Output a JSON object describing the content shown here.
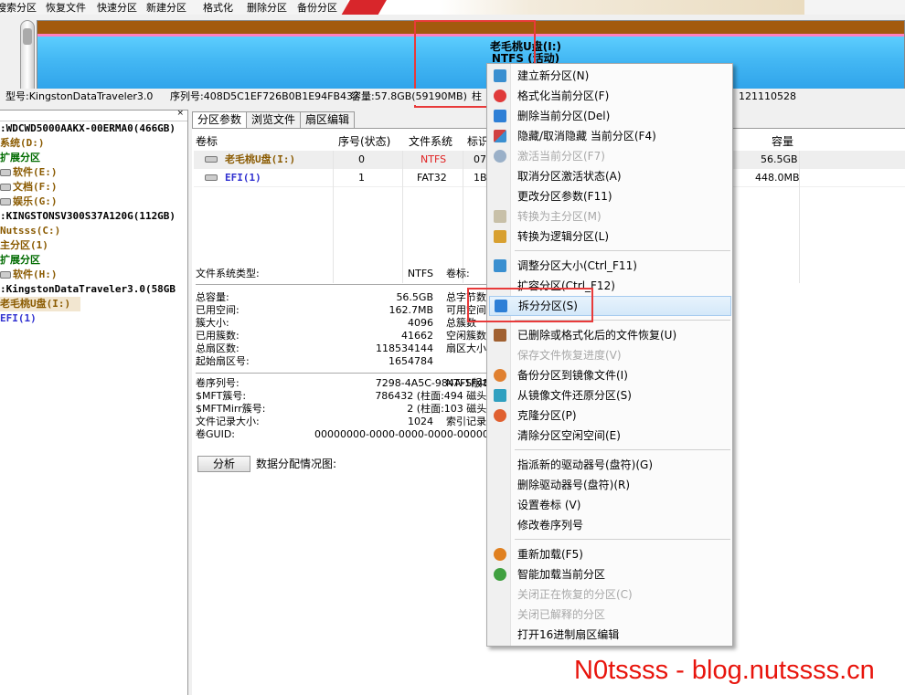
{
  "toolbar": {
    "items": [
      "搜索分区",
      "恢复文件",
      "快速分区",
      "新建分区",
      "格式化",
      "删除分区",
      "备份分区"
    ]
  },
  "disk": {
    "partition_label": "老毛桃U盘(I:)",
    "partition_fs": "NTFS (活动)",
    "info": {
      "model": "型号:KingstonDataTraveler3.0",
      "serial": "序列号:408D5C1EF726B0B1E94FB437",
      "capacity": "容量:57.8GB(59190MB)",
      "col": "柱",
      "sectors": "121110528"
    }
  },
  "tree": {
    "items": [
      {
        "text": ":WDCWD5000AAKX-00ERMA0(466GB)",
        "color": "black"
      },
      {
        "text": "系统(D:)",
        "color": "brown"
      },
      {
        "text": "扩展分区",
        "color": "green"
      },
      {
        "text": "软件(E:)",
        "color": "brown"
      },
      {
        "text": "文档(F:)",
        "color": "brown"
      },
      {
        "text": "娱乐(G:)",
        "color": "brown"
      },
      {
        "text": ":KINGSTONSV300S37A120G(112GB)",
        "color": "black"
      },
      {
        "text": "Nutsss(C:)",
        "color": "brown"
      },
      {
        "text": "主分区(1)",
        "color": "brown"
      },
      {
        "text": "扩展分区",
        "color": "green"
      },
      {
        "text": "软件(H:)",
        "color": "brown"
      },
      {
        "text": ":KingstonDataTraveler3.0(58GB",
        "color": "black"
      },
      {
        "text": "老毛桃U盘(I:)",
        "color": "brown"
      },
      {
        "text": "EFI(1)",
        "color": "blue"
      }
    ]
  },
  "tabs": [
    "分区参数",
    "浏览文件",
    "扇区编辑"
  ],
  "partition_table": {
    "headers": [
      "卷标",
      "序号(状态)",
      "文件系统",
      "标识",
      "容量"
    ],
    "rows": [
      {
        "label": "老毛桃U盘(I:)",
        "index": "0",
        "fs": "NTFS",
        "id": "07",
        "size": "56.5GB"
      },
      {
        "label": "EFI(1)",
        "index": "1",
        "fs": "FAT32",
        "id": "1B",
        "size": "448.0MB"
      }
    ]
  },
  "fs_info": {
    "fs_type_label": "文件系统类型:",
    "fs_type_value": "NTFS",
    "volume_label_key": "卷标:",
    "group1": [
      {
        "k": "总容量:",
        "v": "56.5GB",
        "k2": "总字节数"
      },
      {
        "k": "已用空间:",
        "v": "162.7MB",
        "k2": "可用空间"
      },
      {
        "k": "簇大小:",
        "v": "4096",
        "k2": "总簇数"
      },
      {
        "k": "已用簇数:",
        "v": "41662",
        "k2": "空闲簇数"
      },
      {
        "k": "总扇区数:",
        "v": "118534144",
        "k2": "扇区大小"
      },
      {
        "k": "起始扇区号:",
        "v": "1654784",
        "k2": ""
      }
    ],
    "group2": [
      {
        "k": "卷序列号:",
        "v": "7298-4A5C-984A-1F4B",
        "k2": "NTFS版本"
      },
      {
        "k": "$MFT簇号:",
        "v": "786432 (柱面:494 磁头:",
        "k2": ""
      },
      {
        "k": "$MFTMirr簇号:",
        "v": "2 (柱面:103 磁头:",
        "k2": ""
      },
      {
        "k": "文件记录大小:",
        "v": "1024",
        "k2": "索引记录"
      },
      {
        "k": "卷GUID:",
        "v": "00000000-0000-0000-0000-00000000",
        "k2": ""
      }
    ]
  },
  "analyze": {
    "button": "分析",
    "label": "数据分配情况图:"
  },
  "context_menu": {
    "items": [
      {
        "label": "建立新分区(N)",
        "disabled": false,
        "icon": "new-partition-icon",
        "color": "#3a8fd0"
      },
      {
        "label": "格式化当前分区(F)",
        "disabled": false,
        "icon": "format-icon",
        "color": "#e03a3a"
      },
      {
        "label": "删除当前分区(Del)",
        "disabled": false,
        "icon": "delete-icon",
        "color": "#2e7fd6"
      },
      {
        "label": "隐藏/取消隐藏 当前分区(F4)",
        "disabled": false,
        "icon": "hide-icon",
        "color": "#d04040"
      },
      {
        "label": "激活当前分区(F7)",
        "disabled": true,
        "icon": "activate-icon",
        "color": "#9ab0c8"
      },
      {
        "label": "取消分区激活状态(A)",
        "disabled": false,
        "icon": "",
        "color": ""
      },
      {
        "label": "更改分区参数(F11)",
        "disabled": false,
        "icon": "",
        "color": ""
      },
      {
        "label": "转换为主分区(M)",
        "disabled": true,
        "icon": "convert-primary-icon",
        "color": "#c8c0a8"
      },
      {
        "label": "转换为逻辑分区(L)",
        "disabled": false,
        "icon": "convert-logical-icon",
        "color": "#d8a030"
      },
      {
        "label": "调整分区大小(Ctrl_F11)",
        "disabled": false,
        "icon": "resize-icon",
        "color": "#3a8fd0"
      },
      {
        "label": "扩容分区(Ctrl_F12)",
        "disabled": false,
        "icon": "",
        "color": ""
      },
      {
        "label": "拆分分区(S)",
        "disabled": false,
        "icon": "split-icon",
        "color": "#2e7fd6"
      },
      {
        "label": "已删除或格式化后的文件恢复(U)",
        "disabled": false,
        "icon": "recover-icon",
        "color": "#a06030"
      },
      {
        "label": "保存文件恢复进度(V)",
        "disabled": true,
        "icon": "",
        "color": ""
      },
      {
        "label": "备份分区到镜像文件(I)",
        "disabled": false,
        "icon": "backup-icon",
        "color": "#e08030"
      },
      {
        "label": "从镜像文件还原分区(S)",
        "disabled": false,
        "icon": "restore-icon",
        "color": "#30a0c0"
      },
      {
        "label": "克隆分区(P)",
        "disabled": false,
        "icon": "clone-icon",
        "color": "#e06030"
      },
      {
        "label": "清除分区空闲空间(E)",
        "disabled": false,
        "icon": "",
        "color": ""
      },
      {
        "label": "指派新的驱动器号(盘符)(G)",
        "disabled": false,
        "icon": "",
        "color": ""
      },
      {
        "label": "删除驱动器号(盘符)(R)",
        "disabled": false,
        "icon": "",
        "color": ""
      },
      {
        "label": "设置卷标 (V)",
        "disabled": false,
        "icon": "",
        "color": ""
      },
      {
        "label": "修改卷序列号",
        "disabled": false,
        "icon": "",
        "color": ""
      },
      {
        "label": "重新加载(F5)",
        "disabled": false,
        "icon": "reload-icon",
        "color": "#e08020"
      },
      {
        "label": "智能加载当前分区",
        "disabled": false,
        "icon": "smart-load-icon",
        "color": "#40a040"
      },
      {
        "label": "关闭正在恢复的分区(C)",
        "disabled": true,
        "icon": "",
        "color": ""
      },
      {
        "label": "关闭已解释的分区",
        "disabled": true,
        "icon": "",
        "color": ""
      },
      {
        "label": "打开16进制扇区编辑",
        "disabled": false,
        "icon": "",
        "color": ""
      }
    ]
  },
  "watermark": "N0tssss - blog.nutssss.cn"
}
